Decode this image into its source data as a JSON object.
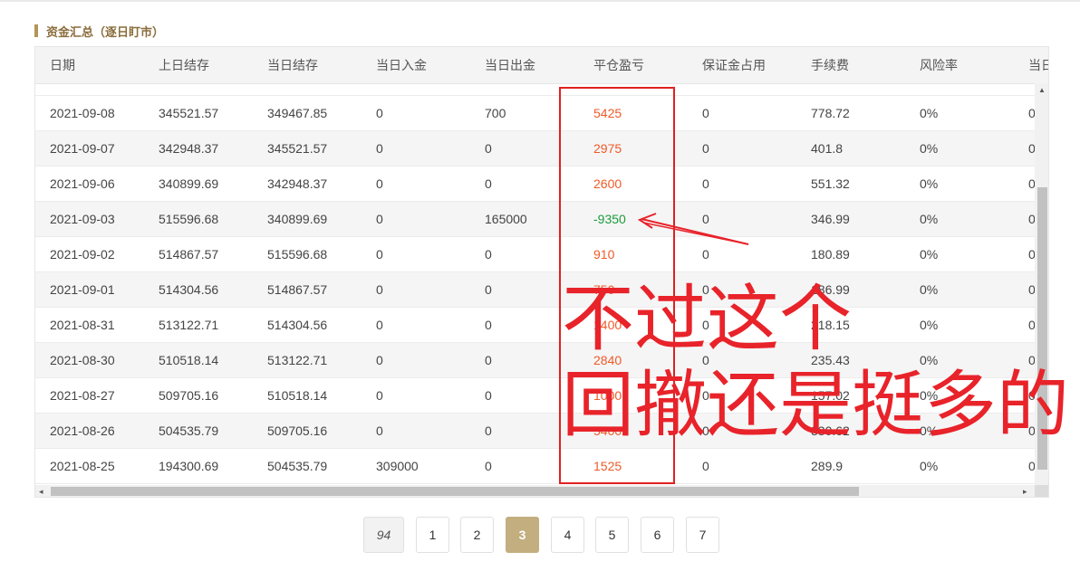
{
  "section_title": "资金汇总（逐日盯市）",
  "columns": [
    "日期",
    "上日结存",
    "当日结存",
    "当日入金",
    "当日出金",
    "平仓盈亏",
    "保证金占用",
    "手续费",
    "风险率",
    "当日"
  ],
  "rows": [
    [
      "2021-09-08",
      "345521.57",
      "349467.85",
      "0",
      "700",
      "5425",
      "0",
      "778.72",
      "0%",
      "0"
    ],
    [
      "2021-09-07",
      "342948.37",
      "345521.57",
      "0",
      "0",
      "2975",
      "0",
      "401.8",
      "0%",
      "0"
    ],
    [
      "2021-09-06",
      "340899.69",
      "342948.37",
      "0",
      "0",
      "2600",
      "0",
      "551.32",
      "0%",
      "0"
    ],
    [
      "2021-09-03",
      "515596.68",
      "340899.69",
      "0",
      "165000",
      "-9350",
      "0",
      "346.99",
      "0%",
      "0"
    ],
    [
      "2021-09-02",
      "514867.57",
      "515596.68",
      "0",
      "0",
      "910",
      "0",
      "180.89",
      "0%",
      "0"
    ],
    [
      "2021-09-01",
      "514304.56",
      "514867.57",
      "0",
      "0",
      "750",
      "0",
      "186.99",
      "0%",
      "0"
    ],
    [
      "2021-08-31",
      "513122.71",
      "514304.56",
      "0",
      "0",
      "1400",
      "0",
      "218.15",
      "0%",
      "0"
    ],
    [
      "2021-08-30",
      "510518.14",
      "513122.71",
      "0",
      "0",
      "2840",
      "0",
      "235.43",
      "0%",
      "0"
    ],
    [
      "2021-08-27",
      "509705.16",
      "510518.14",
      "0",
      "0",
      "1000",
      "0",
      "157.02",
      "0%",
      "0"
    ],
    [
      "2021-08-26",
      "504535.79",
      "509705.16",
      "0",
      "0",
      "5400",
      "0",
      "330.62",
      "0%",
      "0"
    ],
    [
      "2021-08-25",
      "194300.69",
      "504535.79",
      "309000",
      "0",
      "1525",
      "0",
      "289.9",
      "0%",
      "0"
    ]
  ],
  "annotation": {
    "line1": "不过这个",
    "line2": "回撤还是挺多的"
  },
  "pagination": {
    "total": "94",
    "pages": [
      "1",
      "2",
      "3",
      "4",
      "5",
      "6",
      "7"
    ],
    "active": "3"
  },
  "colors": {
    "profit": "#f05a28",
    "loss": "#1a9c3a",
    "annotation": "#e8232a",
    "accent": "#c3ae7f"
  },
  "icons": {
    "scroll_up": "triangle-up-icon",
    "scroll_left": "triangle-left-icon",
    "scroll_right": "triangle-right-icon",
    "annotation_arrow": "arrow-icon"
  }
}
